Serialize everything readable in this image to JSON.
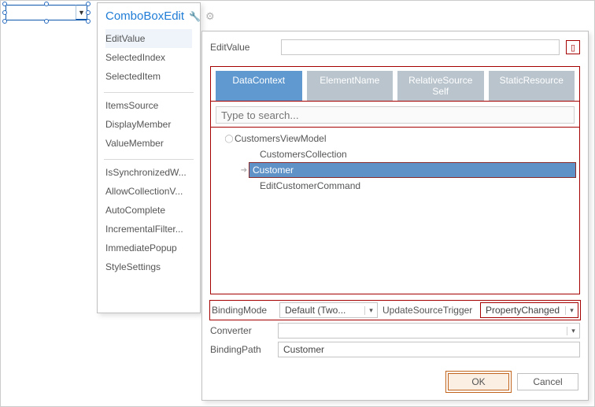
{
  "leftPanel": {
    "title": "ComboBoxEdit",
    "groups": [
      [
        "EditValue",
        "SelectedIndex",
        "SelectedItem"
      ],
      [
        "ItemsSource",
        "DisplayMember",
        "ValueMember"
      ],
      [
        "IsSynchronizedW...",
        "AllowCollectionV...",
        "AutoComplete",
        "IncrementalFilter...",
        "ImmediatePopup",
        "StyleSettings"
      ]
    ]
  },
  "rightPanel": {
    "editValueLabel": "EditValue",
    "tabs": [
      "DataContext",
      "ElementName",
      "RelativeSource Self",
      "StaticResource"
    ],
    "searchPlaceholder": "Type to search...",
    "tree": {
      "root": "CustomersViewModel",
      "children": [
        "CustomersCollection",
        "Customer",
        "EditCustomerCommand"
      ],
      "selected": "Customer"
    },
    "form": {
      "bindingModeLabel": "BindingMode",
      "bindingModeValue": "Default (Two...",
      "ustLabel": "UpdateSourceTrigger",
      "ustValue": "PropertyChanged",
      "converterLabel": "Converter",
      "converterValue": "",
      "bindingPathLabel": "BindingPath",
      "bindingPathValue": "Customer"
    },
    "buttons": {
      "ok": "OK",
      "cancel": "Cancel"
    }
  }
}
